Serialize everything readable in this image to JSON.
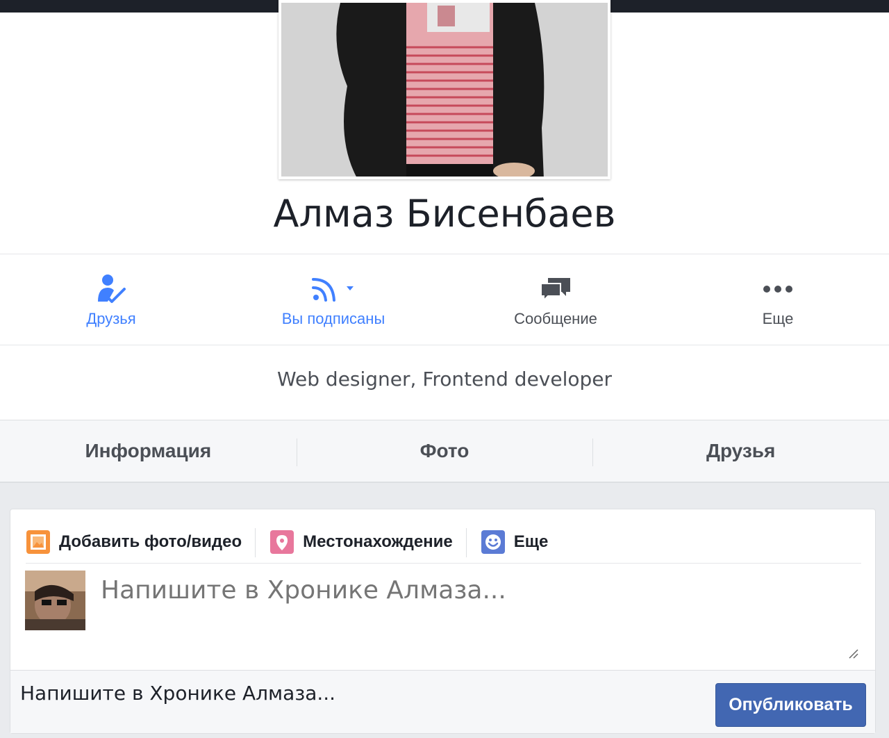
{
  "profile": {
    "name": "Алмаз Бисенбаев",
    "bio": "Web designer, Frontend developer"
  },
  "actions": [
    {
      "label": "Друзья",
      "icon": "friends-check-icon",
      "color": "#4080ff"
    },
    {
      "label": "Вы подписаны",
      "icon": "rss-following-icon",
      "color": "#4080ff"
    },
    {
      "label": "Сообщение",
      "icon": "chat-bubbles-icon",
      "color": "#4b4f56"
    },
    {
      "label": "Еще",
      "icon": "more-dots-icon",
      "color": "#4b4f56"
    }
  ],
  "tabs": [
    {
      "label": "Информация"
    },
    {
      "label": "Фото"
    },
    {
      "label": "Друзья"
    }
  ],
  "composer": {
    "actions": [
      {
        "label": "Добавить фото/видео",
        "icon": "photo-video-icon",
        "color": "#f7923b"
      },
      {
        "label": "Местонахождение",
        "icon": "location-pin-icon",
        "color": "#e8779c"
      },
      {
        "label": "Еще",
        "icon": "smiley-icon",
        "color": "#5b7bd5"
      }
    ],
    "placeholder": "Напишите в Хронике Алмаза...",
    "footer_text": "Напишите в Хронике Алмаза...",
    "publish_label": "Опубликовать"
  },
  "colors": {
    "accent": "#4080ff",
    "button": "#4267b2",
    "cover": "#1d2129"
  }
}
